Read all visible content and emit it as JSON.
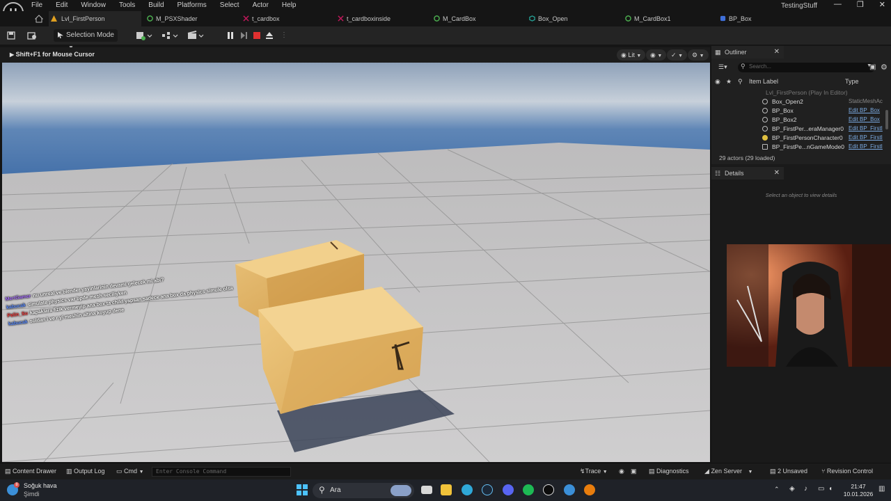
{
  "menubar": {
    "items": [
      "File",
      "Edit",
      "Window",
      "Tools",
      "Build",
      "Platforms",
      "Select",
      "Actor",
      "Help"
    ],
    "project_name": "TestingStuff",
    "window_controls": [
      "—",
      "❐",
      "✕"
    ]
  },
  "tabs": [
    {
      "label": "Lvl_FirstPerson",
      "icon": "level-icon",
      "color": "#e0a020"
    },
    {
      "label": "M_PSXShader",
      "icon": "material-icon",
      "color": "#4caf50"
    },
    {
      "label": "t_cardbox",
      "icon": "texture-icon",
      "color": "#c2185b"
    },
    {
      "label": "t_cardboxinside",
      "icon": "texture-icon",
      "color": "#c2185b"
    },
    {
      "label": "M_CardBox",
      "icon": "material-icon",
      "color": "#4caf50"
    },
    {
      "label": "Box_Open",
      "icon": "static-mesh-icon",
      "color": "#26a69a"
    },
    {
      "label": "M_CardBox1",
      "icon": "material-icon",
      "color": "#4caf50"
    },
    {
      "label": "BP_Box",
      "icon": "blueprint-icon",
      "color": "#3f6fd8"
    }
  ],
  "toolbar": {
    "selection_mode": "Selection Mode"
  },
  "viewport": {
    "hint": "Shift+F1 for Mouse Cursor",
    "view_mode": "Lit"
  },
  "chat": [
    {
      "user": "MertGamer",
      "user_color": "#a970ff",
      "text": "nu unreal ve blender yayinlarinin devami gelecek mi abi?"
    },
    {
      "user": "kabucak",
      "user_color": "#5b8cff",
      "text": "simulate physics var bpde mesh seciliyken"
    },
    {
      "user": "Pelin_Su",
      "user_color": "#ff3b3b",
      "text": "kapaklara fizik vermeyip ana box ta child yapsan sadece ana box da physics simule olsa"
    },
    {
      "user": "kabucak",
      "user_color": "#5b8cff",
      "text": "soldan l ve r yi meshin altina koyup dene"
    }
  ],
  "outliner": {
    "title": "Outliner",
    "search_placeholder": "Search...",
    "col_label": "Item Label",
    "col_type": "Type",
    "rows": [
      {
        "name": "Lvl_FirstPerson (Play In Editor)",
        "type": "",
        "dim": true
      },
      {
        "name": "Box_Open2",
        "type": "StaticMeshAc",
        "link": false
      },
      {
        "name": "BP_Box",
        "type": "Edit BP_Box",
        "link": true
      },
      {
        "name": "BP_Box2",
        "type": "Edit BP_Box",
        "link": true
      },
      {
        "name": "BP_FirstPer...eraManager0",
        "type": "Edit BP_FirstI",
        "link": true
      },
      {
        "name": "BP_FirstPersonCharacter0",
        "type": "Edit BP_FirstI",
        "link": true
      },
      {
        "name": "BP_FirstPe...nGameMode0",
        "type": "Edit BP_FirstI",
        "link": true
      }
    ],
    "actors_count": "29 actors (29 loaded)"
  },
  "details": {
    "title": "Details",
    "empty_text": "Select an object to view details"
  },
  "statusbar": {
    "content_drawer": "Content Drawer",
    "output_log": "Output Log",
    "cmd": "Cmd",
    "console_placeholder": "Enter Console Command",
    "trace": "Trace",
    "diagnostics": "Diagnostics",
    "zen_server": "Zen Server",
    "unsaved": "2 Unsaved",
    "revision_control": "Revision Control"
  },
  "taskbar": {
    "weather_title": "Soğuk hava",
    "weather_sub": "Şimdi",
    "weather_badge": "8",
    "search_label": "Ara",
    "time": "21:47",
    "date": "10.01.2026"
  }
}
